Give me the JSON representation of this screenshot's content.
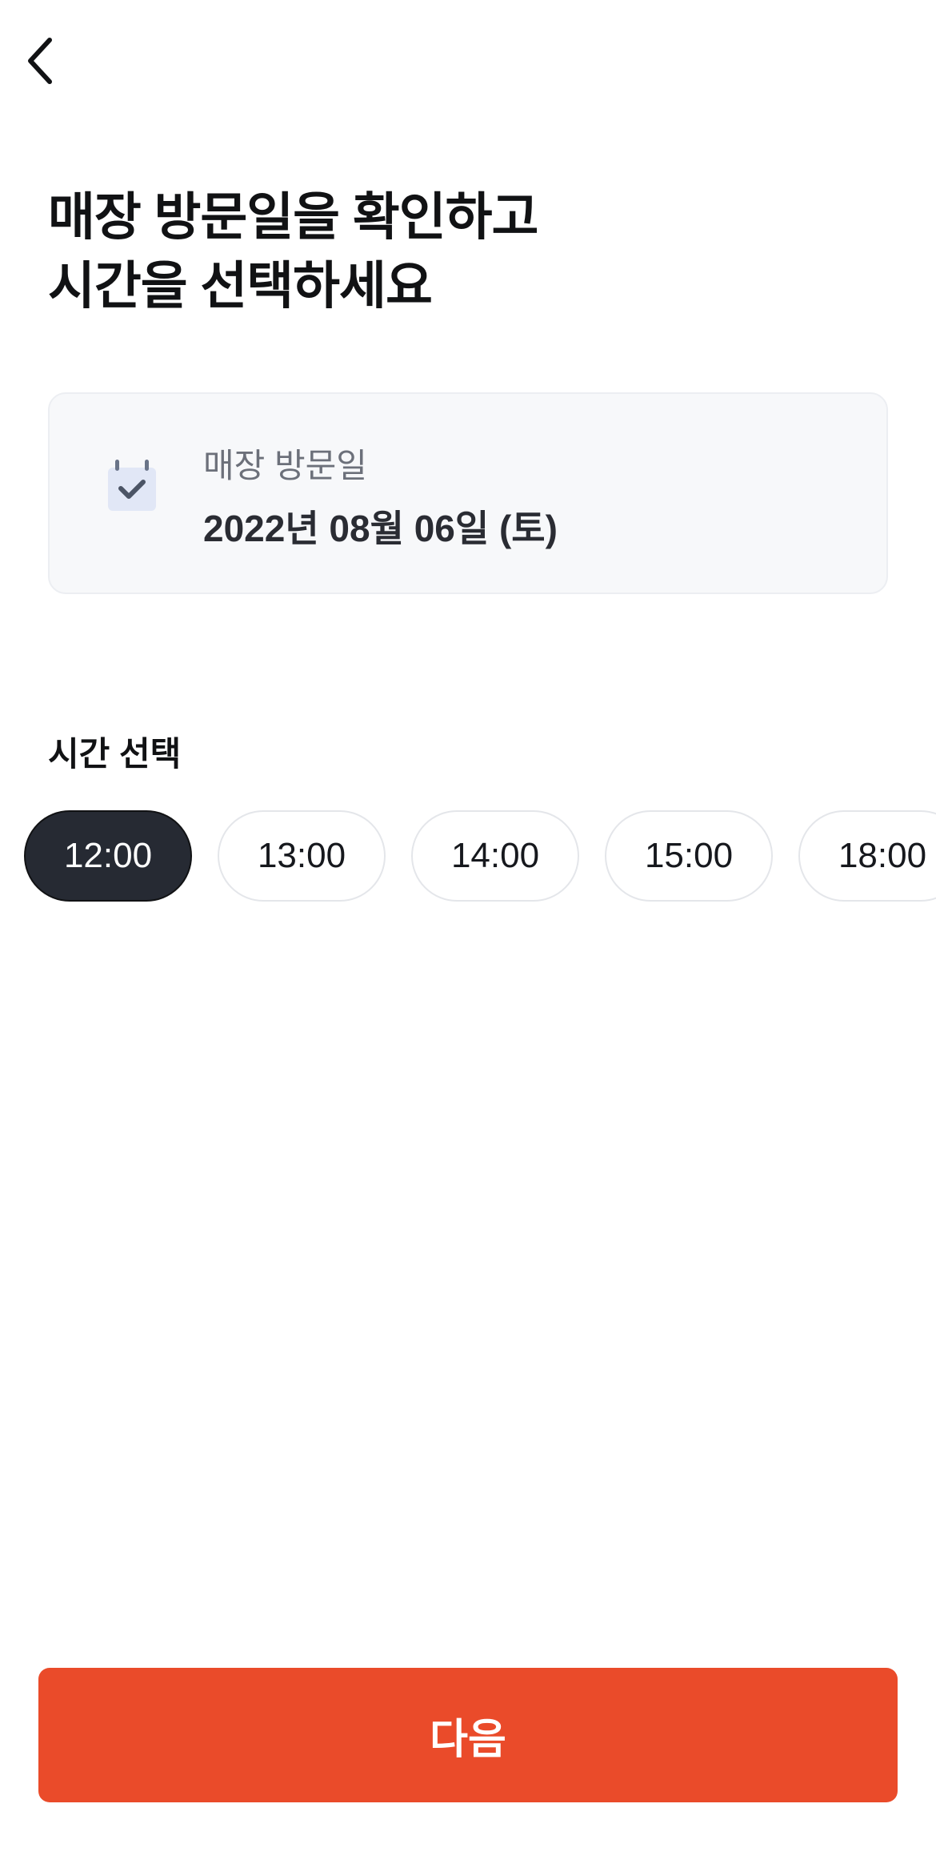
{
  "header": {
    "back_icon": "chevron-left-icon"
  },
  "title": {
    "line1": "매장 방문일을 확인하고",
    "line2": "시간을 선택하세요"
  },
  "visit_date": {
    "icon": "calendar-check-icon",
    "label": "매장 방문일",
    "value": "2022년 08월 06일 (토)"
  },
  "time_section": {
    "title": "시간 선택",
    "selected": "12:00",
    "slots": [
      "12:00",
      "13:00",
      "14:00",
      "15:00",
      "18:00"
    ]
  },
  "footer": {
    "next_label": "다음"
  },
  "colors": {
    "accent": "#ea4b2a",
    "selected_chip": "#262a33",
    "card_background": "#f7f8fa"
  }
}
